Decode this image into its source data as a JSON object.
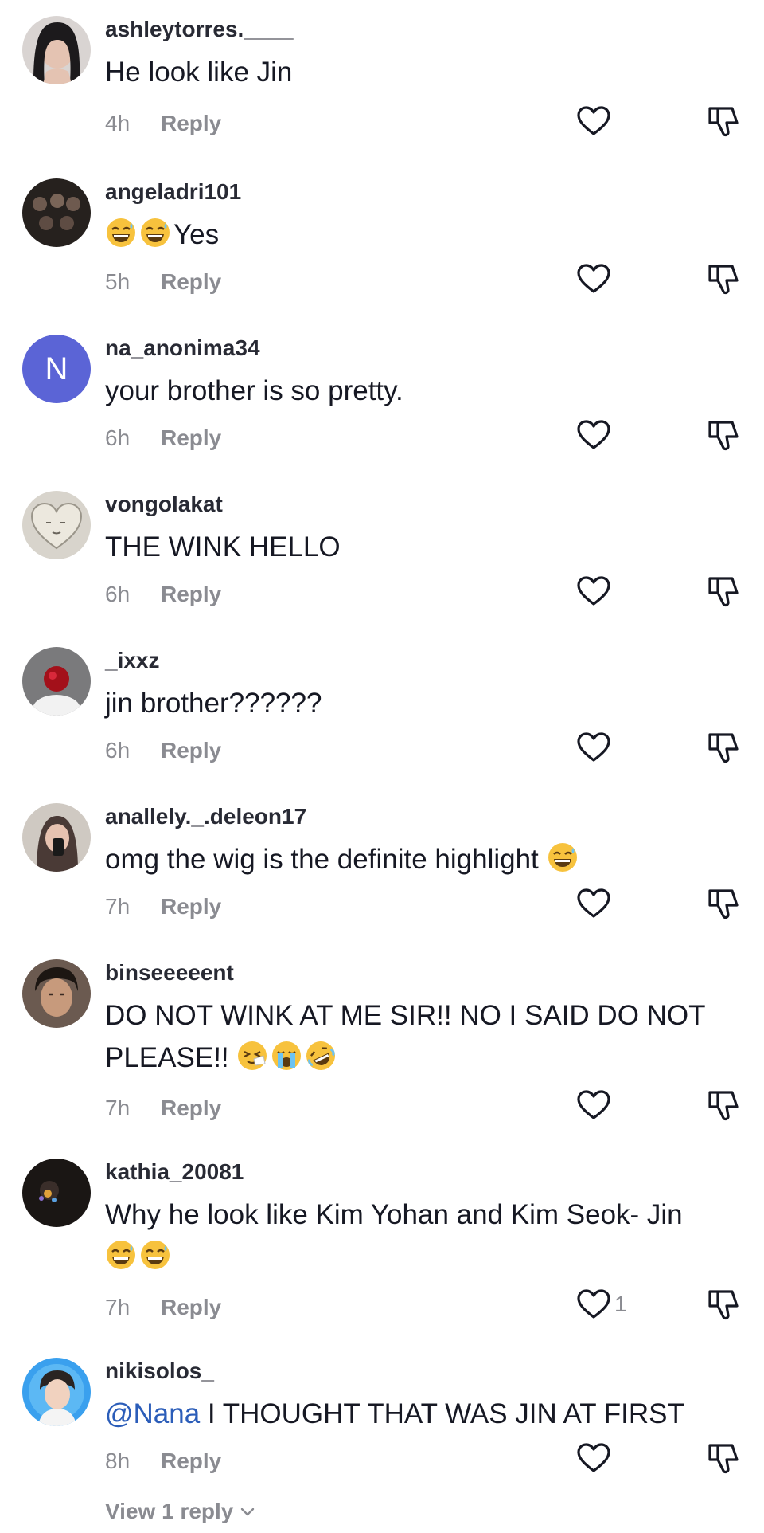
{
  "comments": [
    {
      "username": "ashleytorres.____",
      "text": "He look like Jin",
      "time": "4h",
      "reply_label": "Reply",
      "avatar": "profile-photo",
      "like_count": ""
    },
    {
      "username": "angeladri101",
      "text": "Yes",
      "emojis": [
        "grinning-sweat-emoji",
        "grinning-sweat-emoji"
      ],
      "time": "5h",
      "reply_label": "Reply",
      "avatar": "profile-photo",
      "like_count": ""
    },
    {
      "username": "na_anonima34",
      "text": "your brother is so pretty.",
      "time": "6h",
      "reply_label": "Reply",
      "avatar_letter": "N",
      "avatar_color": "#5b64d6",
      "like_count": ""
    },
    {
      "username": "vongolakat",
      "text": "THE WINK HELLO",
      "time": "6h",
      "reply_label": "Reply",
      "avatar": "profile-photo",
      "like_count": ""
    },
    {
      "username": "_ixxz",
      "text": "jin brother??????",
      "time": "6h",
      "reply_label": "Reply",
      "avatar": "profile-photo",
      "like_count": ""
    },
    {
      "username": "anallely._.deleon17",
      "text": "omg the wig is the definite highlight",
      "emojis_after": [
        "grinning-sweat-emoji"
      ],
      "time": "7h",
      "reply_label": "Reply",
      "avatar": "profile-photo",
      "like_count": ""
    },
    {
      "username": "binseeeeent",
      "text": "DO NOT WINK AT ME SIR!! NO I SAID DO NOT PLEASE!!",
      "emojis_after": [
        "sneezing-face-emoji",
        "loudly-crying-emoji",
        "rolling-laughing-emoji"
      ],
      "time": "7h",
      "reply_label": "Reply",
      "avatar": "profile-photo",
      "like_count": ""
    },
    {
      "username": "kathia_20081",
      "text": "Why he look like Kim Yohan and Kim Seok- Jin",
      "emojis_after": [
        "grinning-sweat-emoji",
        "grinning-sweat-emoji"
      ],
      "time": "7h",
      "reply_label": "Reply",
      "avatar": "profile-photo",
      "like_count": "1"
    },
    {
      "username": "nikisolos_",
      "mention": "@Nana",
      "text": " I THOUGHT THAT WAS JIN AT FIRST",
      "time": "8h",
      "reply_label": "Reply",
      "avatar": "profile-photo",
      "like_count": ""
    }
  ],
  "view_replies_label": "View 1 reply",
  "colors": {
    "text": "#161823",
    "muted": "#8a8b91",
    "mention": "#2b5db9"
  },
  "icons": {
    "like": "heart-outline-icon",
    "dislike": "thumbs-down-outline-icon",
    "expand": "chevron-down-icon"
  }
}
